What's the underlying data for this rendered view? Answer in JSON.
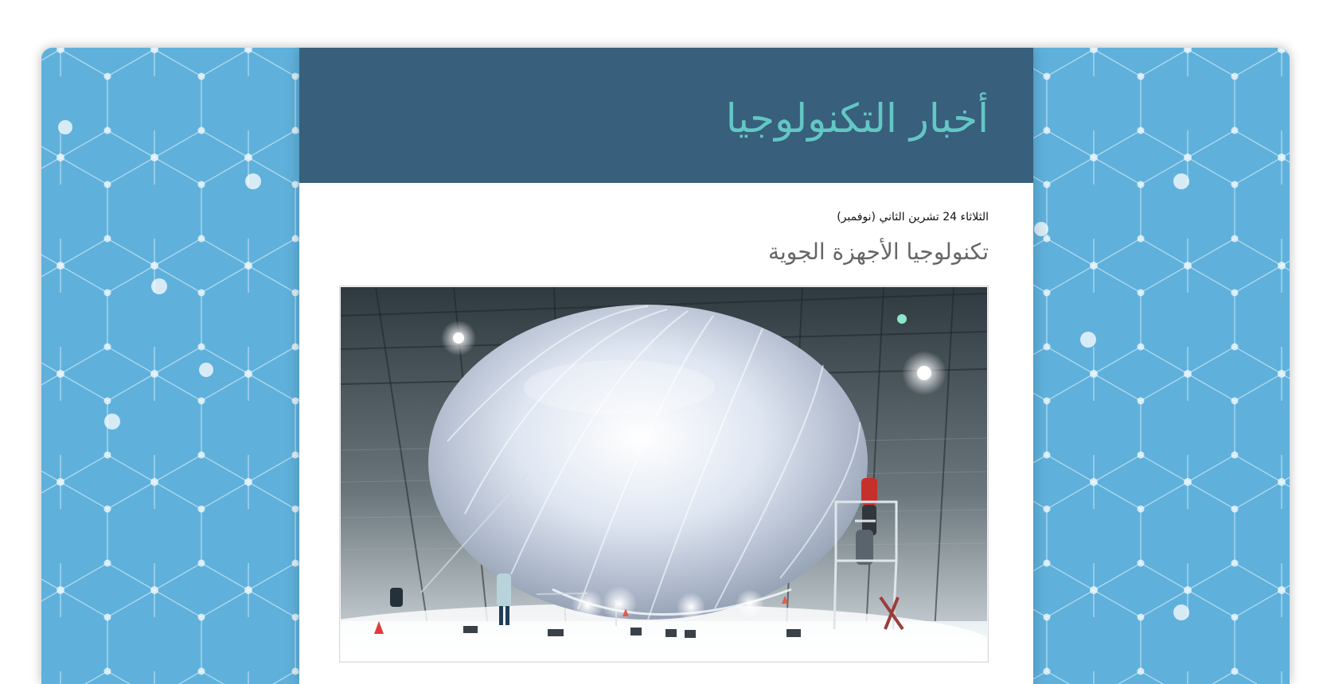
{
  "header": {
    "site_title": "أخبار التكنولوجيا"
  },
  "post": {
    "date": "الثلاثاء 24 تشرين الثاني (نوفمبر)",
    "title": "تكنولوجيا الأجهزة الجوية"
  },
  "colors": {
    "page_background": "#5fb1dc",
    "masthead": "#385f7b",
    "title_accent": "#63c7c5",
    "content_background": "#ffffff"
  },
  "icons": {
    "background_pattern": "hexagon-network-pattern"
  }
}
